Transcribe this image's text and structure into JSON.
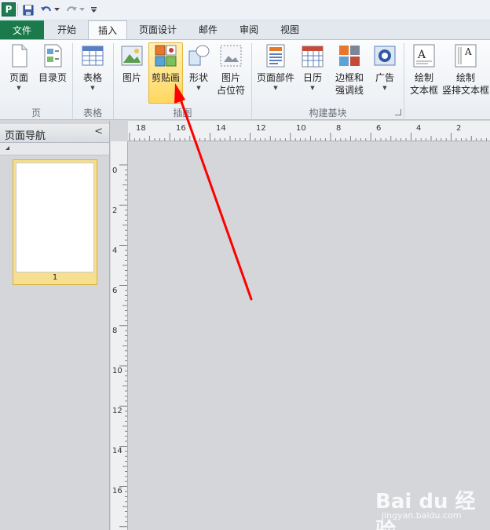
{
  "quick_access": {
    "app_logo": "P",
    "items": [
      "save-icon",
      "undo-icon",
      "redo-icon",
      "customize-icon"
    ]
  },
  "tabs": [
    {
      "label": "文件",
      "active": false
    },
    {
      "label": "开始",
      "active": false
    },
    {
      "label": "插入",
      "active": true
    },
    {
      "label": "页面设计",
      "active": false
    },
    {
      "label": "邮件",
      "active": false
    },
    {
      "label": "审阅",
      "active": false
    },
    {
      "label": "视图",
      "active": false
    }
  ],
  "ribbon": {
    "groups": [
      {
        "label": "页",
        "buttons": [
          {
            "label": "页面",
            "icon": "page-icon"
          },
          {
            "label": "目录页",
            "icon": "catalog-page-icon"
          }
        ]
      },
      {
        "label": "表格",
        "buttons": [
          {
            "label": "表格",
            "icon": "table-icon"
          }
        ]
      },
      {
        "label": "插图",
        "buttons": [
          {
            "label": "图片",
            "icon": "picture-icon"
          },
          {
            "label": "剪贴画",
            "icon": "clip-art-icon",
            "highlighted": true
          },
          {
            "label": "形状",
            "icon": "shapes-icon"
          },
          {
            "label": "图片",
            "label2": "占位符",
            "icon": "picture-placeholder-icon"
          }
        ]
      },
      {
        "label": "构建基块",
        "buttons": [
          {
            "label": "页面部件",
            "icon": "page-parts-icon"
          },
          {
            "label": "日历",
            "icon": "calendar-icon"
          },
          {
            "label": "边框和",
            "label2": "强调线",
            "icon": "borders-icon"
          },
          {
            "label": "广告",
            "icon": "advertisement-icon"
          }
        ]
      },
      {
        "label": "",
        "buttons": [
          {
            "label": "绘制",
            "label2": "文本框",
            "icon": "draw-textbox-icon"
          },
          {
            "label": "绘制",
            "label2": "竖排文本框",
            "icon": "draw-vertical-textbox-icon"
          }
        ]
      }
    ]
  },
  "navigation": {
    "title": "页面导航",
    "collapse": "<",
    "pages": [
      {
        "number": "1"
      }
    ]
  },
  "rulers": {
    "horizontal": [
      "18",
      "16",
      "14",
      "12",
      "10",
      "8",
      "6",
      "4",
      "2"
    ],
    "vertical": [
      "0",
      "2",
      "4",
      "6",
      "8",
      "10",
      "12",
      "14",
      "16"
    ]
  },
  "annotation": {
    "color": "#ff0000"
  },
  "watermark": {
    "logo": "Bai du 经验",
    "sub": "jingyan.baidu.com"
  },
  "colors": {
    "file_tab": "#1a7a4c",
    "highlight": "#ffd760",
    "arrow": "#ff0000"
  }
}
